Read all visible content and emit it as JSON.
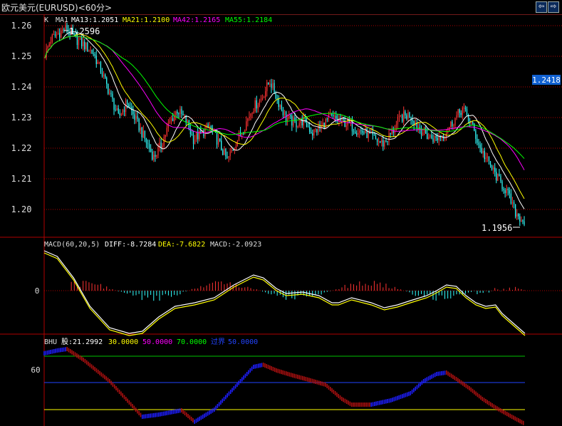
{
  "window": {
    "title": "欧元美元(EURUSD)<60分>",
    "nav_prev": "⇦",
    "nav_next": "⇨",
    "close": "✕"
  },
  "colors": {
    "background": "#000000",
    "up": "#ff3333",
    "down": "#33ffff",
    "grid": "#aa0000",
    "ma13": "#ffffff",
    "ma21": "#ffff00",
    "ma42": "#ff00ff",
    "ma55": "#00ff00",
    "diff": "#ffffff",
    "dea": "#ffff00",
    "bhu_up": "#1e1eff",
    "bhu_down": "#aa1010"
  },
  "chart_data": [
    {
      "type": "candlestick",
      "legend": [
        "K",
        "MA1",
        "MA13:1.2051",
        "MA21:1.2100",
        "MA42:1.2165",
        "MA55:1.2184"
      ],
      "y_ticks": [
        "1.26",
        "1.25",
        "1.24",
        "1.23",
        "1.22",
        "1.21",
        "1.20"
      ],
      "ylim": [
        1.193,
        1.262
      ],
      "price_marker": "1.2418",
      "high_label": "1.2596",
      "low_label": "1.1956",
      "grid": true,
      "close_path": [
        [
          0,
          1.2505
        ],
        [
          4,
          1.2555
        ],
        [
          9,
          1.2575
        ],
        [
          15,
          1.2592
        ],
        [
          20,
          1.256
        ],
        [
          27,
          1.2535
        ],
        [
          33,
          1.251
        ],
        [
          38,
          1.2455
        ],
        [
          44,
          1.238
        ],
        [
          50,
          1.23
        ],
        [
          56,
          1.235
        ],
        [
          63,
          1.228
        ],
        [
          68,
          1.223
        ],
        [
          74,
          1.217
        ],
        [
          79,
          1.221
        ],
        [
          85,
          1.2285
        ],
        [
          90,
          1.2325
        ],
        [
          96,
          1.229
        ],
        [
          101,
          1.223
        ],
        [
          107,
          1.225
        ],
        [
          112,
          1.227
        ],
        [
          118,
          1.222
        ],
        [
          124,
          1.216
        ],
        [
          130,
          1.222
        ],
        [
          136,
          1.2275
        ],
        [
          141,
          1.233
        ],
        [
          147,
          1.236
        ],
        [
          153,
          1.242
        ],
        [
          158,
          1.236
        ],
        [
          164,
          1.23
        ],
        [
          170,
          1.228
        ],
        [
          176,
          1.229
        ],
        [
          182,
          1.225
        ],
        [
          188,
          1.227
        ],
        [
          194,
          1.23
        ],
        [
          200,
          1.229
        ],
        [
          206,
          1.228
        ],
        [
          212,
          1.226
        ],
        [
          218,
          1.225
        ],
        [
          224,
          1.223
        ],
        [
          230,
          1.2215
        ],
        [
          236,
          1.225
        ],
        [
          242,
          1.23
        ],
        [
          248,
          1.231
        ],
        [
          254,
          1.227
        ],
        [
          260,
          1.224
        ],
        [
          266,
          1.223
        ],
        [
          272,
          1.225
        ],
        [
          278,
          1.229
        ],
        [
          284,
          1.233
        ],
        [
          290,
          1.228
        ],
        [
          296,
          1.22
        ],
        [
          302,
          1.215
        ],
        [
          308,
          1.21
        ],
        [
          314,
          1.206
        ],
        [
          320,
          1.199
        ],
        [
          326,
          1.196
        ]
      ]
    },
    {
      "type": "line",
      "legend": [
        "MACD(60,20,5)",
        "DIFF:-8.7284",
        "DEA:-7.6822",
        "MACD:-2.0923"
      ],
      "y_ticks": [
        "0"
      ]
    },
    {
      "type": "line",
      "legend": [
        "BHU",
        "股:21.2992",
        "30.0000",
        "50.0000",
        "70.0000",
        "过界",
        "50.0000"
      ],
      "y_ticks": [
        "60"
      ]
    }
  ]
}
